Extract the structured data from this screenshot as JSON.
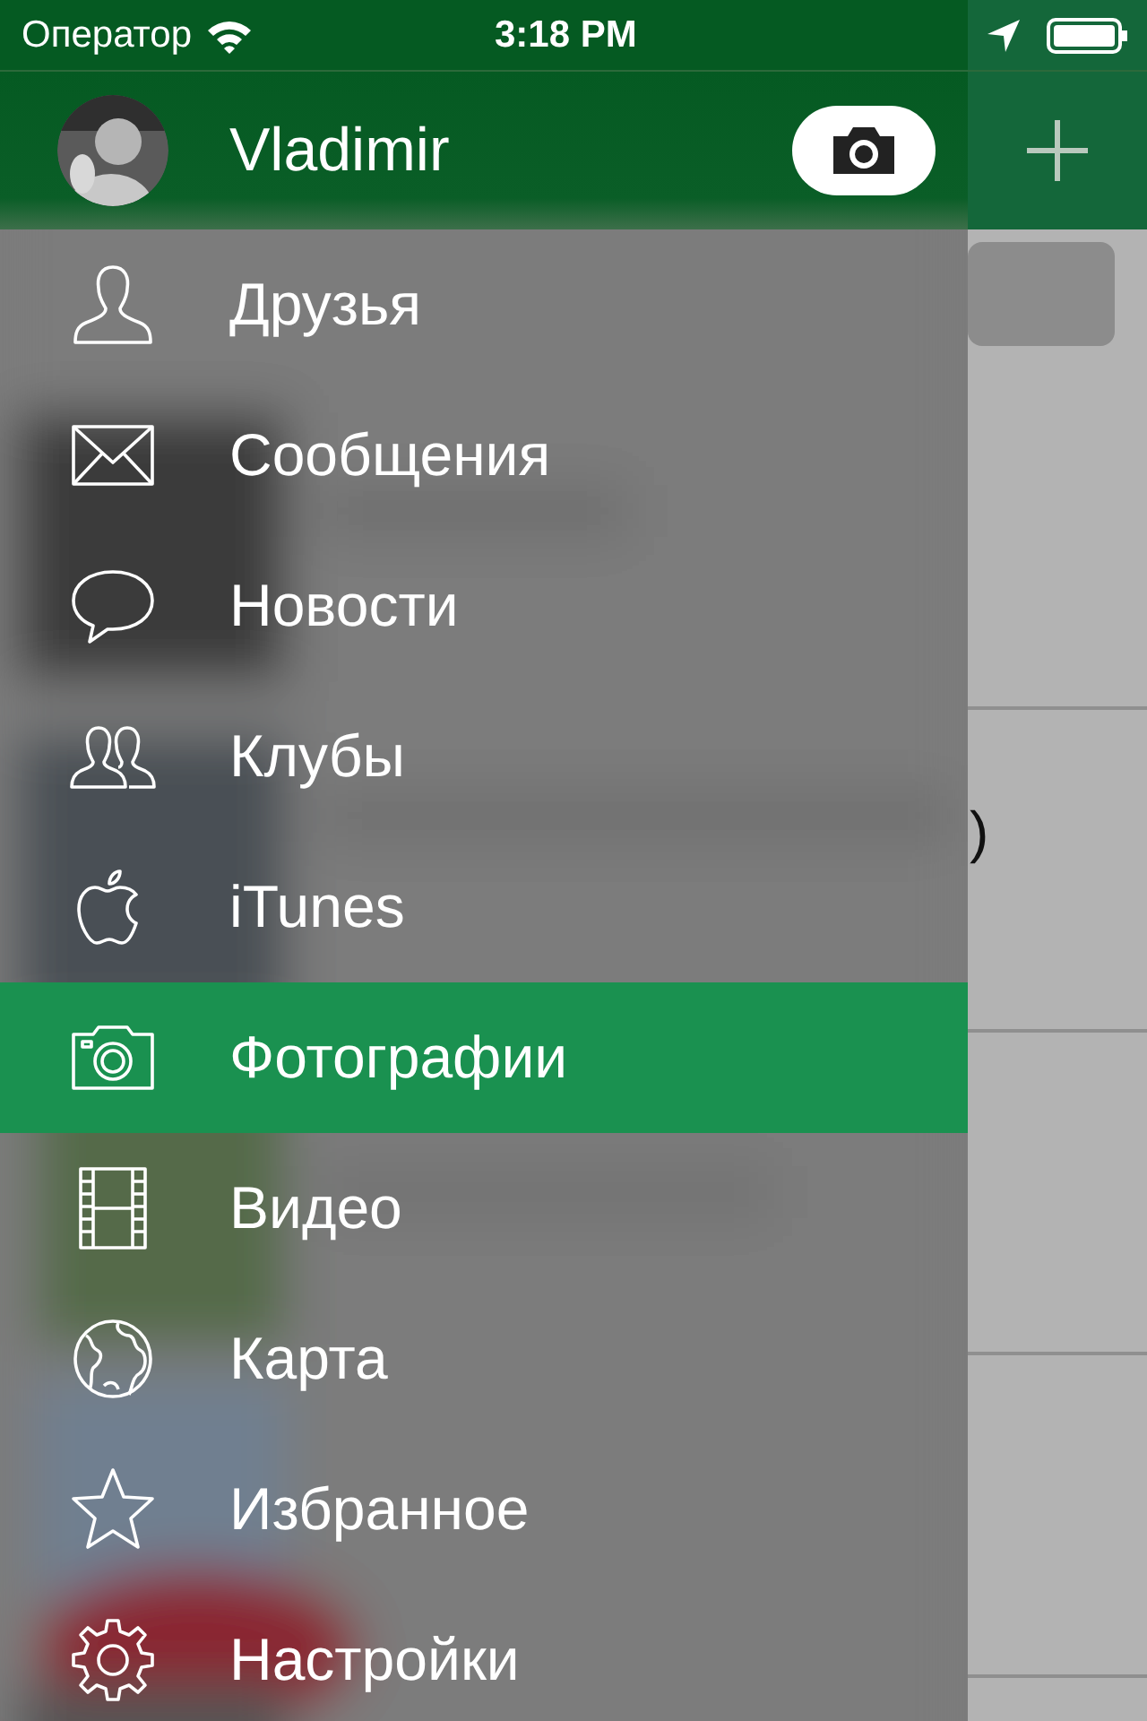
{
  "status_bar": {
    "carrier": "Оператор",
    "time": "3:18 PM"
  },
  "profile": {
    "name": "Vladimir"
  },
  "menu": {
    "items": [
      {
        "label": "Друзья",
        "selected": false
      },
      {
        "label": "Сообщения",
        "selected": false
      },
      {
        "label": "Новости",
        "selected": false
      },
      {
        "label": "Клубы",
        "selected": false
      },
      {
        "label": "iTunes",
        "selected": false
      },
      {
        "label": "Фотографии",
        "selected": true
      },
      {
        "label": "Видео",
        "selected": false
      },
      {
        "label": "Карта",
        "selected": false
      },
      {
        "label": "Избранное",
        "selected": false
      },
      {
        "label": "Настройки",
        "selected": false
      }
    ]
  },
  "background_list": {
    "rows": [
      {
        "text": ")"
      }
    ]
  }
}
